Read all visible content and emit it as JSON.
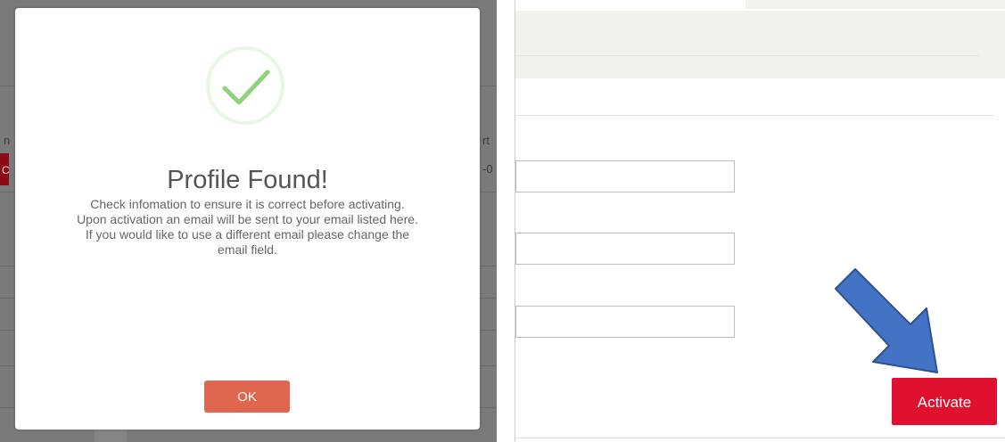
{
  "modal": {
    "icon": "checkmark-circle-icon",
    "title": "Profile Found!",
    "message_lines": [
      "Check infomation to ensure it is correct before activating.",
      "Upon activation an email will be sent to your email listed here.",
      "If you would like to use a different email please change the",
      "email field."
    ],
    "ok_label": "OK"
  },
  "background": {
    "left_header_fragment": "n",
    "right_header_fragment": "rt",
    "left_cell_fragment": "C",
    "right_cell_fragment": "-0"
  },
  "form": {
    "fields": [
      {
        "value": ""
      },
      {
        "value": ""
      },
      {
        "value": ""
      }
    ],
    "activate_label": "Activate"
  },
  "annotation": {
    "icon": "arrow-down-right-icon"
  },
  "colors": {
    "ok_button": "#e0674f",
    "activate_button": "#e0112e",
    "check_green": "#8fd27c",
    "arrow_fill": "#4472c4",
    "arrow_stroke": "#2f528f"
  }
}
